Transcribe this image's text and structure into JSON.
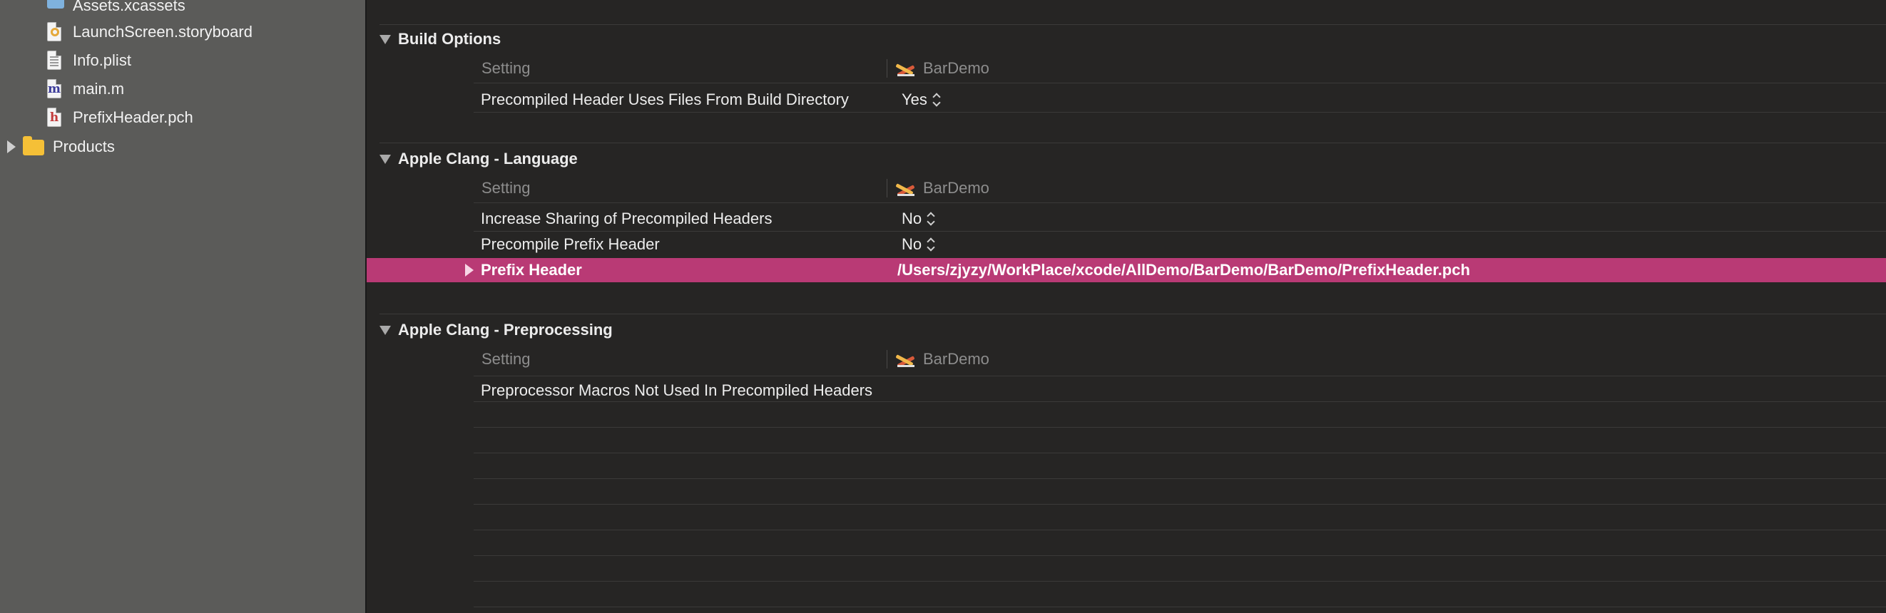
{
  "navigator": {
    "items": [
      {
        "label": "Assets.xcassets",
        "icon": "asset-catalog-icon"
      },
      {
        "label": "LaunchScreen.storyboard",
        "icon": "storyboard-file-icon"
      },
      {
        "label": "Info.plist",
        "icon": "plist-file-icon"
      },
      {
        "label": "main.m",
        "icon": "objc-m-file-icon",
        "letter": "m",
        "letter_color": "#3b3b9a"
      },
      {
        "label": "PrefixHeader.pch",
        "icon": "header-file-icon",
        "letter": "h",
        "letter_color": "#c23b3b"
      },
      {
        "label": "Products",
        "icon": "folder-icon"
      }
    ]
  },
  "sections": [
    {
      "title": "Build Options",
      "column_header": "Setting",
      "target": "BarDemo",
      "rows": [
        {
          "label": "Precompiled Header Uses Files From Build Directory",
          "value": "Yes"
        }
      ]
    },
    {
      "title": "Apple Clang - Language",
      "column_header": "Setting",
      "target": "BarDemo",
      "rows": [
        {
          "label": "Increase Sharing of Precompiled Headers",
          "value": "No"
        },
        {
          "label": "Precompile Prefix Header",
          "value": "No"
        },
        {
          "label": "Prefix Header",
          "value": "/Users/zjyzy/WorkPlace/xcode/AllDemo/BarDemo/BarDemo/PrefixHeader.pch",
          "selected": true
        }
      ]
    },
    {
      "title": "Apple Clang - Preprocessing",
      "column_header": "Setting",
      "target": "BarDemo",
      "rows": [
        {
          "label": "Preprocessor Macros Not Used In Precompiled Headers",
          "value": ""
        }
      ]
    }
  ],
  "colors": {
    "sidebar_bg": "#5b5b59",
    "editor_bg": "#262524",
    "selection": "#b93a75",
    "folder": "#f5c037"
  }
}
